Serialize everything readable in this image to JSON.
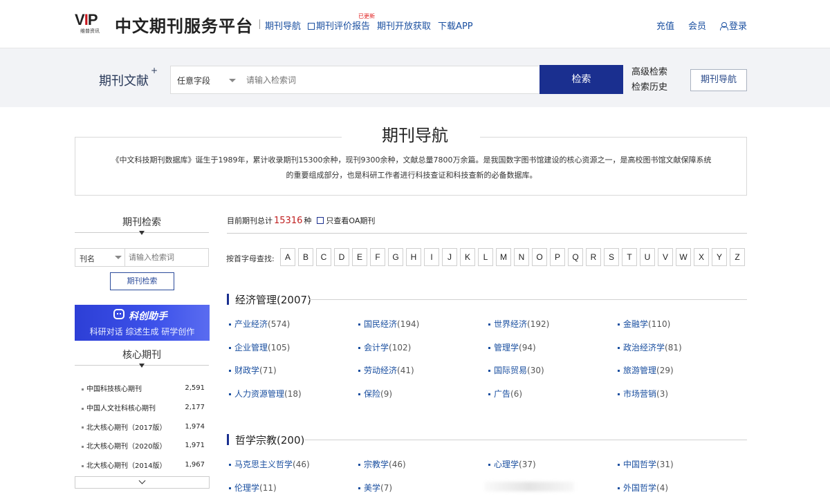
{
  "header": {
    "logo_text_a": "VIP",
    "logo_sub": "维普资讯",
    "site_title": "中文期刊服务平台",
    "nav": [
      "期刊导航",
      "期刊评价报告",
      "期刊开放获取",
      "下载APP"
    ],
    "new_badge": "已更新",
    "right_links": [
      "充值",
      "会员",
      "登录"
    ]
  },
  "search": {
    "label": "期刊文献",
    "plus": "+",
    "field_select": "任意字段",
    "placeholder": "请输入检索词",
    "button": "检索",
    "advanced": "高级检索",
    "history": "检索历史",
    "nav_button": "期刊导航"
  },
  "page": {
    "title": "期刊导航",
    "intro_line1": "《中文科技期刊数据库》诞生于1989年，累计收录期刊15300余种，现刊9300余种，文献总量7800万余篇。是我国数字图书馆建设的核心资源之一，是高校图书馆文献保障系统",
    "intro_line2": "的重要组成部分，也是科研工作者进行科技查证和科技查新的必备数据库。"
  },
  "sidebar": {
    "search_title": "期刊检索",
    "select": "刊名",
    "placeholder": "请输入检索词",
    "button": "期刊检索",
    "ai_title": "科创助手",
    "ai_sub": "科研对话  综述生成  研学创作",
    "core_title": "核心期刊",
    "core_items": [
      {
        "name": "中国科技核心期刊",
        "count": "2,591"
      },
      {
        "name": "中国人文社科核心期刊",
        "count": "2,177"
      },
      {
        "name": "北大核心期刊（2017版）",
        "count": "1,974"
      },
      {
        "name": "北大核心期刊（2020版）",
        "count": "1,971"
      },
      {
        "name": "北大核心期刊（2014版）",
        "count": "1,967"
      }
    ]
  },
  "main": {
    "total_prefix": "目前期刊总计",
    "total_count": "15316",
    "total_suffix": "种",
    "oa_label": "只查看OA期刊",
    "letters_label": "按首字母查找:",
    "letters": [
      "A",
      "B",
      "C",
      "D",
      "E",
      "F",
      "G",
      "H",
      "I",
      "J",
      "K",
      "L",
      "M",
      "N",
      "O",
      "P",
      "Q",
      "R",
      "S",
      "T",
      "U",
      "V",
      "W",
      "X",
      "Y",
      "Z"
    ],
    "categories": [
      {
        "title": "经济管理(2007)",
        "items": [
          {
            "name": "产业经济",
            "count": "(574)"
          },
          {
            "name": "国民经济",
            "count": "(194)"
          },
          {
            "name": "世界经济",
            "count": "(192)"
          },
          {
            "name": "金融学",
            "count": "(110)"
          },
          {
            "name": "企业管理",
            "count": "(105)"
          },
          {
            "name": "会计学",
            "count": "(102)"
          },
          {
            "name": "管理学",
            "count": "(94)"
          },
          {
            "name": "政治经济学",
            "count": "(81)"
          },
          {
            "name": "财政学",
            "count": "(71)"
          },
          {
            "name": "劳动经济",
            "count": "(41)"
          },
          {
            "name": "国际贸易",
            "count": "(30)"
          },
          {
            "name": "旅游管理",
            "count": "(29)"
          },
          {
            "name": "人力资源管理",
            "count": "(18)"
          },
          {
            "name": "保险",
            "count": "(9)"
          },
          {
            "name": "广告",
            "count": "(6)"
          },
          {
            "name": "市场营销",
            "count": "(3)"
          }
        ]
      },
      {
        "title": "哲学宗教(200)",
        "items": [
          {
            "name": "马克思主义哲学",
            "count": "(46)"
          },
          {
            "name": "宗教学",
            "count": "(46)"
          },
          {
            "name": "心理学",
            "count": "(37)"
          },
          {
            "name": "中国哲学",
            "count": "(31)"
          },
          {
            "name": "伦理学",
            "count": "(11)"
          },
          {
            "name": "美学",
            "count": "(7)"
          },
          {
            "name": "",
            "count": ""
          },
          {
            "name": "外国哲学",
            "count": "(4)"
          }
        ]
      }
    ]
  },
  "colors": {
    "primary": "#1a2f8f",
    "link": "#1a4fa0",
    "count_red": "#c02020",
    "ai_banner": "#2d3fd6"
  }
}
